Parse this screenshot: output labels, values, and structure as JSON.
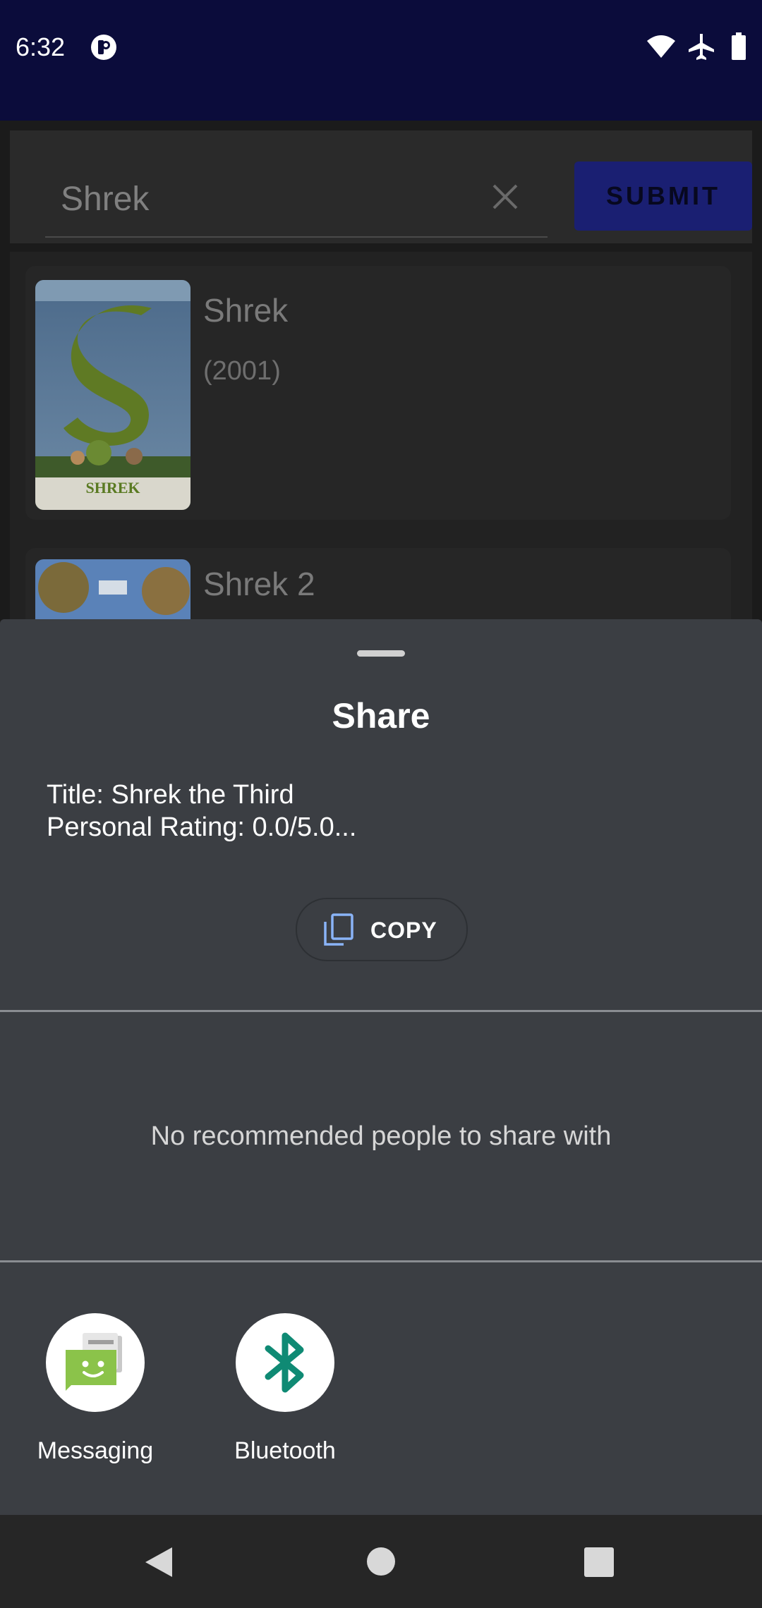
{
  "status_bar": {
    "time": "6:32",
    "icons": [
      "app-notification-icon",
      "wifi-icon",
      "airplane-mode-icon",
      "battery-icon"
    ]
  },
  "search": {
    "query": "Shrek",
    "submit_label": "SUBMIT"
  },
  "results": [
    {
      "title": "Shrek",
      "year": "(2001)",
      "poster_text": "SHREK"
    },
    {
      "title": "Shrek 2",
      "year": ""
    }
  ],
  "share_sheet": {
    "title": "Share",
    "preview_text": "Title: Shrek the Third\nPersonal Rating: 0.0/5.0...",
    "copy_label": "COPY",
    "no_people_text": "No recommended people to share with",
    "targets": [
      {
        "label": "Messaging",
        "icon": "messaging-icon"
      },
      {
        "label": "Bluetooth",
        "icon": "bluetooth-icon"
      }
    ]
  },
  "nav_bar": {
    "buttons": [
      "back-icon",
      "home-icon",
      "recents-icon"
    ]
  },
  "colors": {
    "status_bar": "#0b0c3b",
    "submit_button": "#1a1f72",
    "sheet_background": "#3b3e43",
    "bluetooth": "#0f8a74",
    "messaging": "#8bc34a"
  }
}
